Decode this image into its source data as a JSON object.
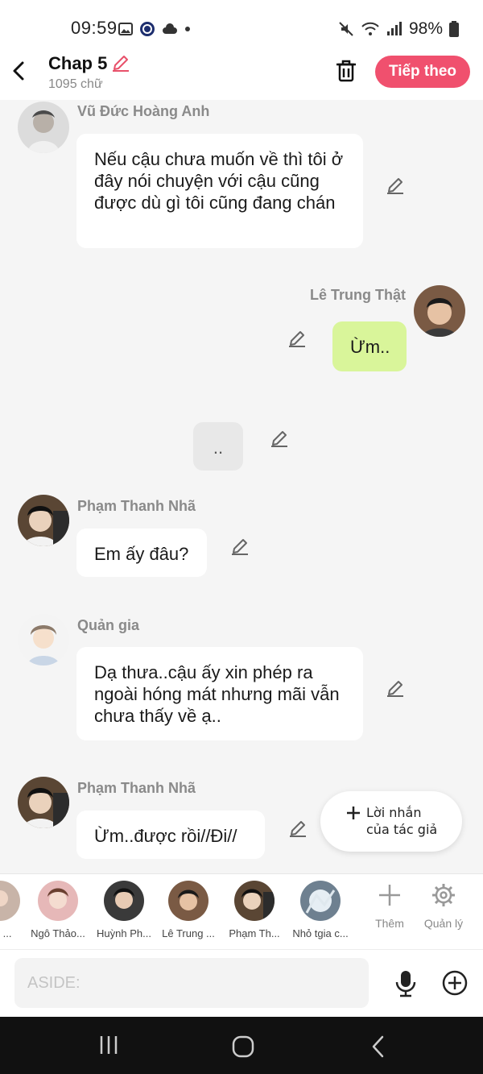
{
  "status_bar": {
    "time": "09:59",
    "battery": "98%"
  },
  "header": {
    "title": "Chap 5",
    "word_count": "1095 chữ",
    "next_label": "Tiếp theo"
  },
  "messages": [
    {
      "sender": "Vũ Đức Hoàng Anh",
      "text": "Nếu cậu chưa muốn về thì tôi ở đây nói chuyện với cậu cũng được dù gì tôi cũng đang chán"
    },
    {
      "sender": "Lê Trung Thật",
      "text": "Ừm.."
    },
    {
      "text": ".."
    },
    {
      "sender": "Phạm Thanh Nhã",
      "text": "Em ấy đâu?"
    },
    {
      "sender": "Quản gia",
      "text": "Dạ thưa..cậu ấy xin phép ra ngoài hóng mát nhưng mãi vẫn chưa thấy về ạ.."
    },
    {
      "sender": "Phạm Thanh Nhã",
      "text": "Ừm..được rồi//Đi//"
    }
  ],
  "author_note": {
    "line1": "Lời nhắn",
    "line2": "của tác giả"
  },
  "characters": [
    {
      "name": "Lê ..."
    },
    {
      "name": "Ngô Thảo..."
    },
    {
      "name": "Huỳnh Ph..."
    },
    {
      "name": "Lê Trung ..."
    },
    {
      "name": "Phạm Th..."
    },
    {
      "name": "Nhỏ tgia c..."
    }
  ],
  "tools": {
    "add_label": "Thêm",
    "manage_label": "Quản lý"
  },
  "input": {
    "placeholder": "ASIDE:"
  },
  "colors": {
    "accent": "#f0506e",
    "mine_bubble": "#d9f59a",
    "edit_icon": "#e8506a"
  }
}
